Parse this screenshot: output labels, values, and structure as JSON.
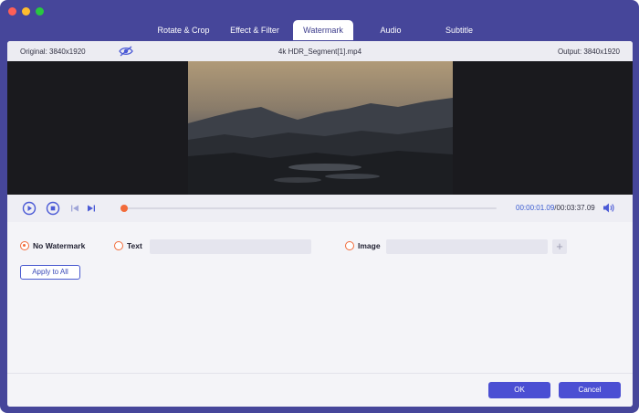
{
  "window": {
    "controls": [
      "close",
      "minimize",
      "maximize"
    ]
  },
  "tabs": [
    {
      "label": "Rotate & Crop",
      "active": false
    },
    {
      "label": "Effect & Filter",
      "active": false
    },
    {
      "label": "Watermark",
      "active": true
    },
    {
      "label": "Audio",
      "active": false
    },
    {
      "label": "Subtitle",
      "active": false
    }
  ],
  "info": {
    "original": "Original: 3840x1920",
    "filename": "4k HDR_Segment[1].mp4",
    "output": "Output: 3840x1920",
    "preview_toggle_icon": "eye-slash-icon"
  },
  "player": {
    "play_icon": "play-icon",
    "stop_icon": "stop-icon",
    "prev_icon": "previous-frame-icon",
    "next_icon": "next-frame-icon",
    "current_time": "00:00:01.09",
    "total_time": "/00:03:37.09",
    "progress_fraction": 0.005,
    "volume_icon": "volume-icon"
  },
  "watermark": {
    "none_label": "No Watermark",
    "text_label": "Text",
    "text_value": "",
    "image_label": "Image",
    "image_value": "",
    "selected": "none",
    "add_image_icon": "plus-icon",
    "apply_all_label": "Apply to All"
  },
  "footer": {
    "ok_label": "OK",
    "cancel_label": "Cancel"
  },
  "colors": {
    "frame": "#46469a",
    "accent": "#4b4fd3",
    "radio": "#f26b3a",
    "time_current": "#3a5bd0"
  }
}
